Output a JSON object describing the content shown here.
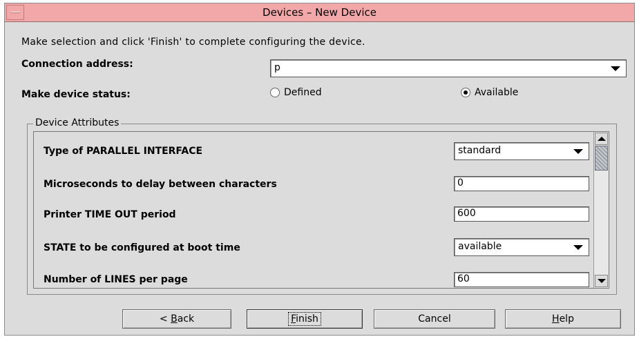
{
  "window": {
    "title": "Devices – New Device"
  },
  "instructions": "Make selection and click 'Finish' to complete configuring the device.",
  "connection": {
    "label": "Connection address:",
    "value": "p"
  },
  "status": {
    "label": "Make device status:",
    "options": [
      {
        "label": "Defined",
        "selected": false
      },
      {
        "label": "Available",
        "selected": true
      }
    ]
  },
  "attributes": {
    "title": "Device Attributes",
    "rows": [
      {
        "label": "Type of PARALLEL INTERFACE",
        "kind": "combo",
        "value": "standard"
      },
      {
        "label": "Microseconds to delay between characters",
        "kind": "text",
        "value": "0"
      },
      {
        "label": "Printer TIME OUT period",
        "kind": "text",
        "value": "600"
      },
      {
        "label": "STATE to be configured at boot time",
        "kind": "combo",
        "value": "available"
      },
      {
        "label": "Number of LINES per page",
        "kind": "text",
        "value": "60"
      }
    ]
  },
  "buttons": {
    "back_prefix": "< ",
    "back_mnemonic": "B",
    "back_rest": "ack",
    "finish_mnemonic": "F",
    "finish_rest": "inish",
    "cancel": "Cancel",
    "help_mnemonic": "H",
    "help_rest": "elp"
  },
  "colors": {
    "titlebar": "#f2a8a8",
    "dialog_bg": "#dcdcdc"
  }
}
